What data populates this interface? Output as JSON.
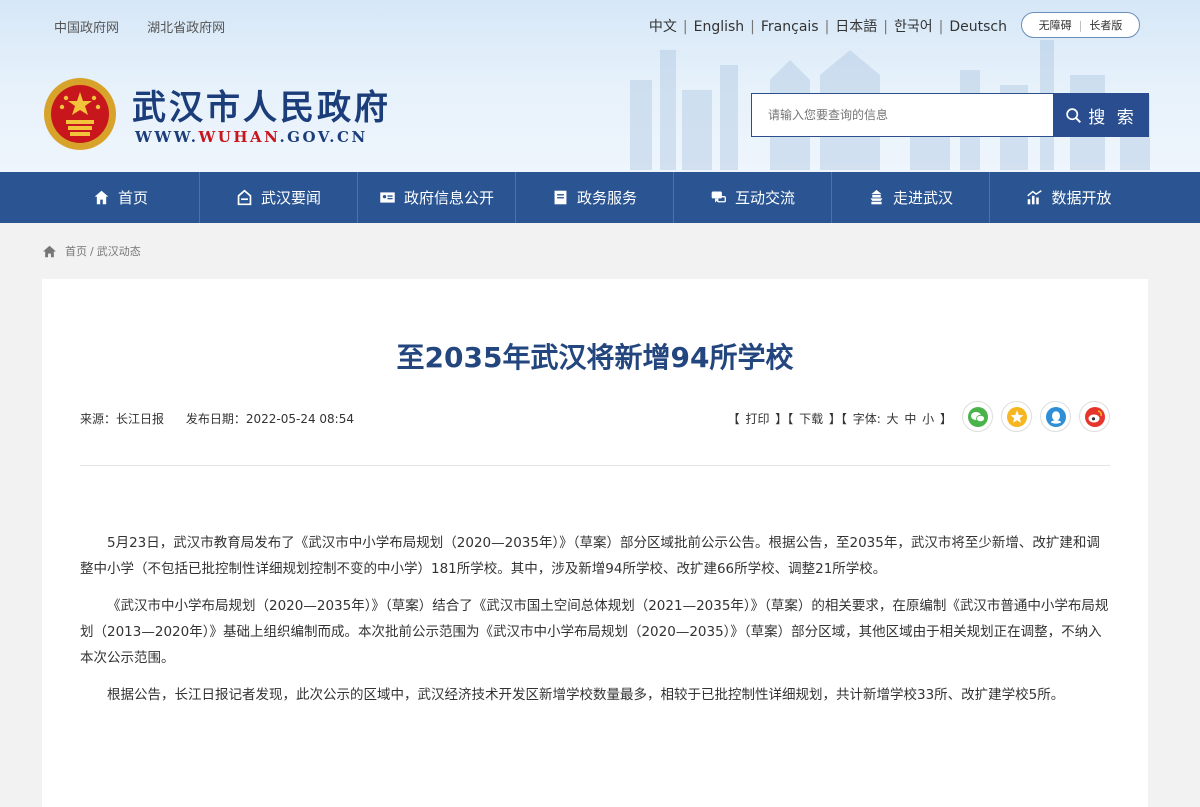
{
  "header": {
    "top_links": [
      "中国政府网",
      "湖北省政府网"
    ],
    "languages": [
      "中文",
      "English",
      "Français",
      "日本語",
      "한국어",
      "Deutsch"
    ],
    "accessibility": [
      "无障碍",
      "长者版"
    ],
    "site_name": "武汉市人民政府",
    "domain_pre": "WWW.",
    "domain_red": "WUHAN",
    "domain_post": ".GOV.CN",
    "search_placeholder": "请输入您要查询的信息",
    "search_button": "搜 索"
  },
  "nav": [
    {
      "label": "首页",
      "icon": "home-icon"
    },
    {
      "label": "武汉要闻",
      "icon": "inbox-icon"
    },
    {
      "label": "政府信息公开",
      "icon": "id-card-icon"
    },
    {
      "label": "政务服务",
      "icon": "folder-icon"
    },
    {
      "label": "互动交流",
      "icon": "chat-icon"
    },
    {
      "label": "走进武汉",
      "icon": "building-icon"
    },
    {
      "label": "数据开放",
      "icon": "chart-icon"
    }
  ],
  "breadcrumb": {
    "home": "首页",
    "sep": "/",
    "current": "武汉动态"
  },
  "article": {
    "title": "至2035年武汉将新增94所学校",
    "source": "来源：长江日报",
    "date": "发布日期：2022-05-24 08:54",
    "tools": "【 打印 】【 下载 】【 字体: 大 中 小 】",
    "share_icons": [
      "wechat-icon",
      "star-icon",
      "qq-icon",
      "weibo-icon"
    ],
    "paragraphs": [
      "5月23日，武汉市教育局发布了《武汉市中小学布局规划（2020—2035年）》（草案）部分区域批前公示公告。根据公告，至2035年，武汉市将至少新增、改扩建和调整中小学（不包括已批控制性详细规划控制不变的中小学）181所学校。其中，涉及新增94所学校、改扩建66所学校、调整21所学校。",
      "《武汉市中小学布局规划（2020—2035年）》（草案）结合了《武汉市国土空间总体规划（2021—2035年）》（草案）的相关要求，在原编制《武汉市普通中小学布局规划（2013—2020年）》基础上组织编制而成。本次批前公示范围为《武汉市中小学布局规划（2020—2035）》（草案）部分区域，其他区域由于相关规划正在调整，不纳入本次公示范围。",
      "根据公告，长江日报记者发现，此次公示的区域中，武汉经济技术开发区新增学校数量最多，相较于已批控制性详细规划，共计新增学校33所、改扩建学校5所。"
    ]
  },
  "colors": {
    "nav": "#2a5592",
    "title": "#23467f",
    "accent_red": "#c8161d"
  }
}
